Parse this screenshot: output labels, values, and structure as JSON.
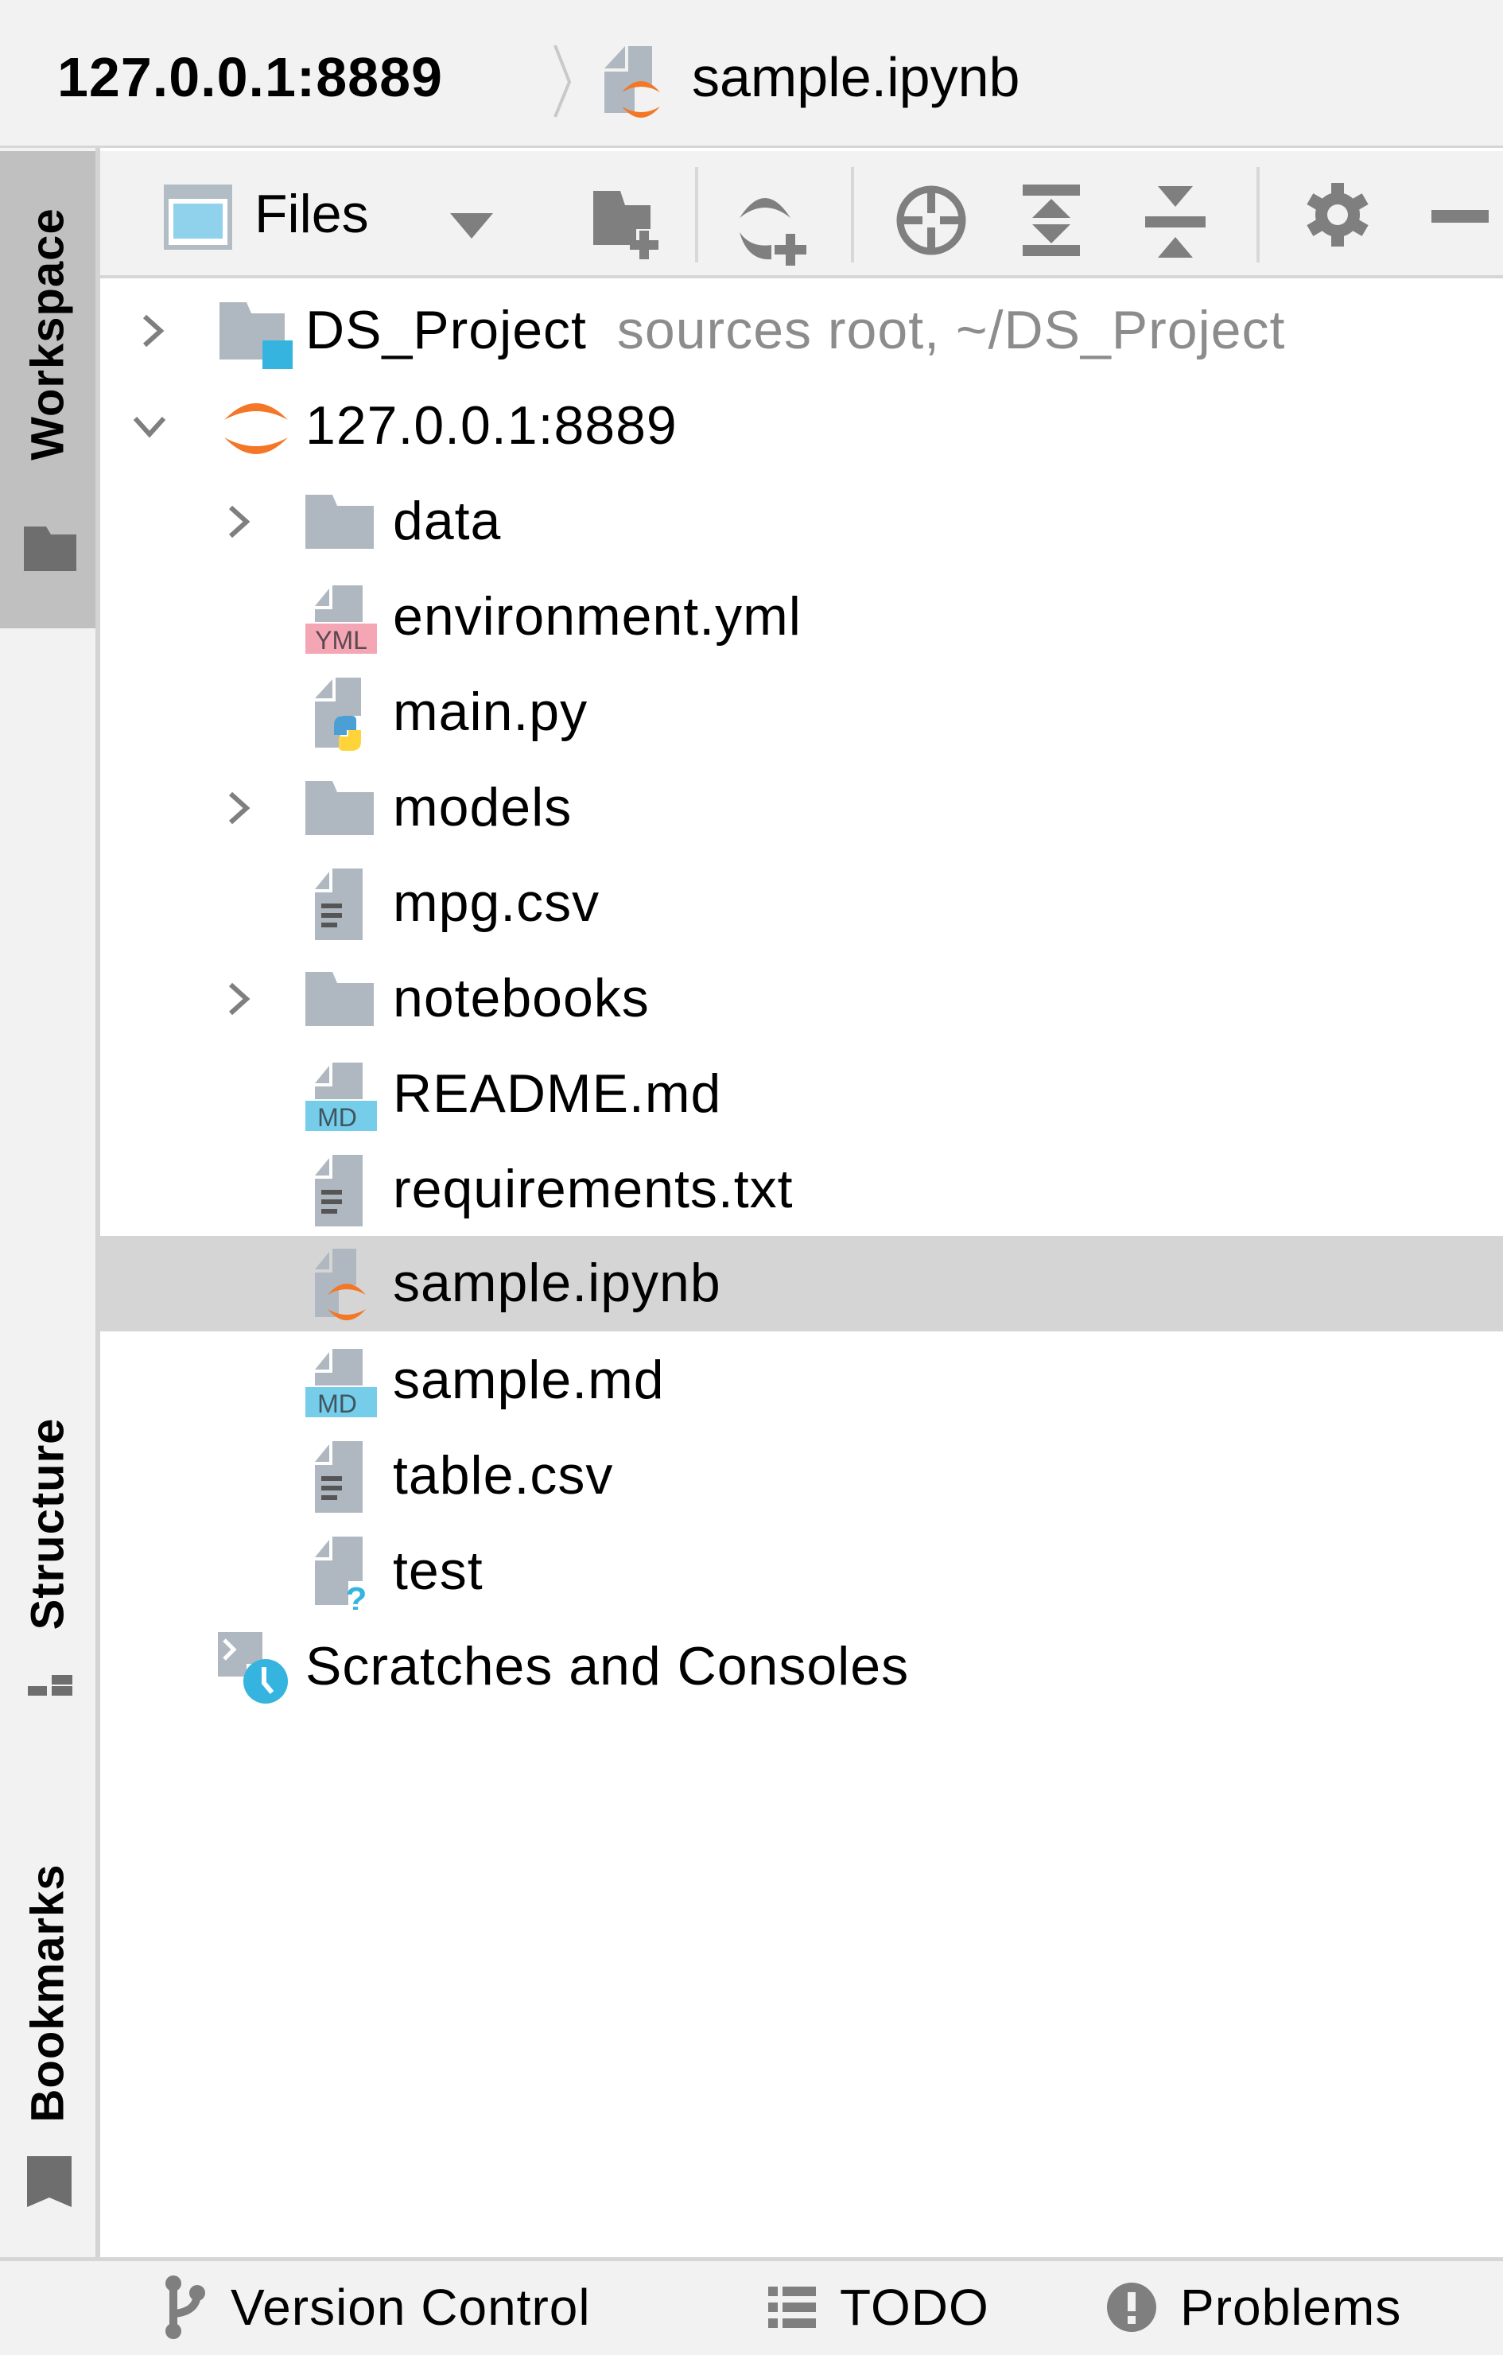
{
  "breadcrumb": {
    "host": "127.0.0.1:8889",
    "file": "sample.ipynb",
    "file_icon": "jupyter-notebook-icon"
  },
  "sidebar": {
    "tabs": [
      {
        "label": "Workspace",
        "icon": "folder-icon",
        "active": true
      },
      {
        "label": "Structure",
        "icon": "structure-icon",
        "active": false
      },
      {
        "label": "Bookmarks",
        "icon": "bookmark-icon",
        "active": false
      }
    ]
  },
  "toolbar": {
    "view_label": "Files",
    "view_icon": "files-view-icon",
    "buttons": [
      {
        "name": "new-folder",
        "icon": "new-folder-icon"
      },
      {
        "name": "add-connection",
        "icon": "refresh-add-icon"
      },
      {
        "name": "locate",
        "icon": "crosshair-icon"
      },
      {
        "name": "expand-all",
        "icon": "expand-all-icon"
      },
      {
        "name": "collapse-all",
        "icon": "collapse-all-icon"
      },
      {
        "name": "settings",
        "icon": "gear-icon"
      },
      {
        "name": "hide",
        "icon": "minus-icon"
      }
    ]
  },
  "tree": {
    "selected": "sample.ipynb",
    "items": [
      {
        "label": "DS_Project",
        "hint": "sources root,  ~/DS_Project",
        "level": 0,
        "expandable": true,
        "expanded": false,
        "icon": "project-folder-icon"
      },
      {
        "label": "127.0.0.1:8889",
        "level": 0,
        "expandable": true,
        "expanded": true,
        "icon": "jupyter-server-icon"
      },
      {
        "label": "data",
        "level": 1,
        "expandable": true,
        "expanded": false,
        "icon": "folder-icon"
      },
      {
        "label": "environment.yml",
        "level": 1,
        "expandable": false,
        "icon": "yaml-file-icon",
        "badge": "YML"
      },
      {
        "label": "main.py",
        "level": 1,
        "expandable": false,
        "icon": "python-file-icon"
      },
      {
        "label": "models",
        "level": 1,
        "expandable": true,
        "expanded": false,
        "icon": "folder-icon"
      },
      {
        "label": "mpg.csv",
        "level": 1,
        "expandable": false,
        "icon": "text-file-icon"
      },
      {
        "label": "notebooks",
        "level": 1,
        "expandable": true,
        "expanded": false,
        "icon": "folder-icon"
      },
      {
        "label": "README.md",
        "level": 1,
        "expandable": false,
        "icon": "markdown-file-icon",
        "badge": "MD"
      },
      {
        "label": "requirements.txt",
        "level": 1,
        "expandable": false,
        "icon": "text-file-icon"
      },
      {
        "label": "sample.ipynb",
        "level": 1,
        "expandable": false,
        "icon": "jupyter-notebook-icon"
      },
      {
        "label": "sample.md",
        "level": 1,
        "expandable": false,
        "icon": "markdown-file-icon",
        "badge": "MD"
      },
      {
        "label": "table.csv",
        "level": 1,
        "expandable": false,
        "icon": "text-file-icon"
      },
      {
        "label": "test",
        "level": 1,
        "expandable": false,
        "icon": "unknown-file-icon"
      },
      {
        "label": "Scratches and Consoles",
        "level": 0,
        "expandable": false,
        "icon": "scratches-icon"
      }
    ]
  },
  "bottombar": {
    "items": [
      {
        "label": "Version Control",
        "icon": "branch-icon"
      },
      {
        "label": "TODO",
        "icon": "list-icon"
      },
      {
        "label": "Problems",
        "icon": "warning-icon"
      }
    ]
  },
  "colors": {
    "accent_blue": "#35b4e0",
    "jupyter_orange": "#f37726",
    "yml_pink": "#f5a6b5",
    "md_blue": "#76cdea",
    "icon_gray": "#7f7f7f",
    "file_gray": "#afb8c0",
    "selection": "#d5d5d5"
  }
}
